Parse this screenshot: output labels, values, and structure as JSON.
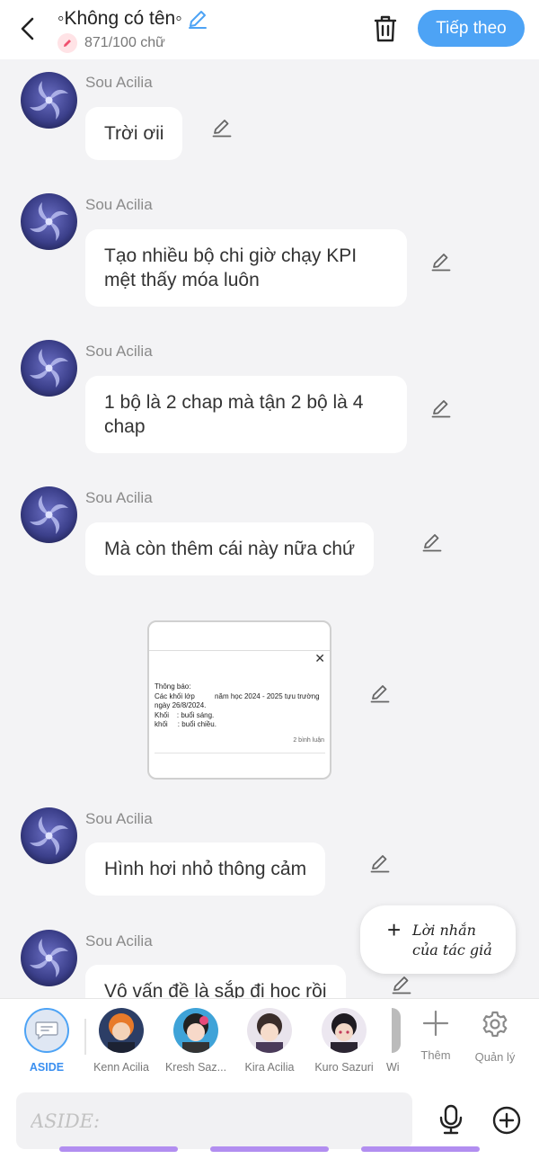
{
  "header": {
    "title": "◦Không có tên◦",
    "counter": "871/100 chữ",
    "next_label": "Tiếp theo"
  },
  "messages": [
    {
      "author": "Sou Acilia",
      "text": "Trời ơii"
    },
    {
      "author": "Sou Acilia",
      "text": "Tạo nhiều bộ chi giờ chạy KPI mệt thấy móa luôn"
    },
    {
      "author": "Sou Acilia",
      "text": "1 bộ là 2 chap mà tận 2 bộ là 4 chap"
    },
    {
      "author": "Sou Acilia",
      "text": "Mà còn thêm cái này nữa chứ"
    },
    {
      "author": "Sou Acilia",
      "text": "Hình hơi nhỏ thông cảm"
    },
    {
      "author": "Sou Acilia",
      "text": "Vô vấn đề là sắp đi học rồi"
    }
  ],
  "image_post": {
    "text": "Thông báo:\nCác khối lớp          năm học 2024 - 2025 tựu trường\nngày 26/8/2024.\nKhối    : buổi sáng.\nkhối     : buổi chiều.",
    "comments": "2 bình luận",
    "close_glyph": "✕"
  },
  "author_note": {
    "plus": "+",
    "label": "Lời nhắn\ncủa tác giả"
  },
  "characters": [
    {
      "label": "ASIDE",
      "active": true
    },
    {
      "label": "Kenn Acilia"
    },
    {
      "label": "Kresh Saz..."
    },
    {
      "label": "Kira Acilia"
    },
    {
      "label": "Kuro Sazuri"
    },
    {
      "label": "Wi"
    }
  ],
  "tools": {
    "add_label": "Thêm",
    "manage_label": "Quản lý"
  },
  "input": {
    "placeholder": "ASIDE:"
  },
  "colors": {
    "accent": "#4da3f5",
    "avatar_bg": "#3b3f8a",
    "swipe": "#b28ef0"
  },
  "icons": [
    "back-arrow-icon",
    "pencil-icon",
    "trash-icon",
    "mic-icon",
    "plus-circle-icon",
    "gear-icon",
    "plus-icon"
  ]
}
